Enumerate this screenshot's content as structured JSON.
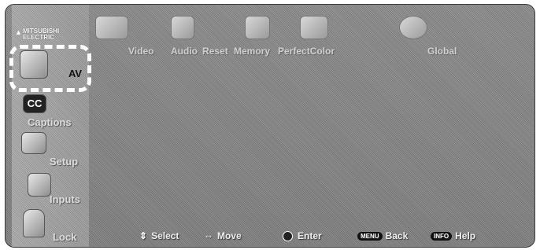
{
  "brand": {
    "line1": "MITSUBISHI",
    "line2": "ELECTRIC"
  },
  "sidebar": {
    "items": [
      {
        "label": "AV",
        "icon": "av-icon",
        "selected": true
      },
      {
        "label": "Captions",
        "icon": "cc-icon",
        "selected": false
      },
      {
        "label": "Setup",
        "icon": "setup-icon",
        "selected": false
      },
      {
        "label": "Inputs",
        "icon": "inputs-icon",
        "selected": false
      },
      {
        "label": "Lock",
        "icon": "lock-icon",
        "selected": false
      }
    ]
  },
  "tabs": [
    {
      "label": "Video",
      "icon": "video-icon"
    },
    {
      "label": "Audio",
      "icon": "audio-icon"
    },
    {
      "label": "Reset",
      "icon": "reset-icon"
    },
    {
      "label": "Memory",
      "icon": "memory-icon"
    },
    {
      "label": "PerfectColor",
      "icon": "perfect-color-icon"
    },
    {
      "label": "Global",
      "icon": "global-icon"
    }
  ],
  "footer": {
    "select": "Select",
    "move": "Move",
    "enter": "Enter",
    "back_key": "MENU",
    "back": "Back",
    "help_key": "INFO",
    "help": "Help"
  },
  "colors": {
    "highlight": "#ffffff",
    "background": "#8a8a8a"
  }
}
